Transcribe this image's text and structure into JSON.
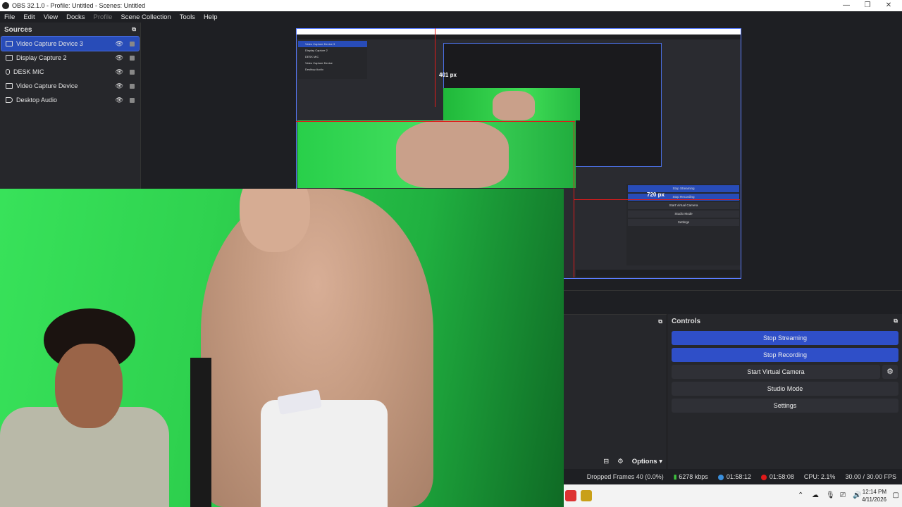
{
  "window": {
    "title": "OBS 32.1.0 - Profile: Untitled - Scenes: Untitled"
  },
  "menu": [
    "File",
    "Edit",
    "View",
    "Docks",
    "Profile",
    "Scene Collection",
    "Tools",
    "Help"
  ],
  "sources": {
    "title": "Sources",
    "items": [
      {
        "label": "Video Capture Device 3",
        "icon": "camera-icon",
        "selected": true
      },
      {
        "label": "Display Capture 2",
        "icon": "monitor-icon",
        "selected": false
      },
      {
        "label": "DESK MIC",
        "icon": "mic-icon",
        "selected": false
      },
      {
        "label": "Video Capture Device",
        "icon": "camera-icon",
        "selected": false
      },
      {
        "label": "Desktop Audio",
        "icon": "speaker-icon",
        "selected": false
      }
    ]
  },
  "preview": {
    "width_label": "401 px",
    "height_label": "720 px",
    "inner_controls": [
      "Stop Streaming",
      "Stop Recording",
      "Start Virtual Camera",
      "Studio Mode",
      "Settings"
    ]
  },
  "controls": {
    "title": "Controls",
    "buttons": {
      "stop_streaming": "Stop Streaming",
      "stop_recording": "Stop Recording",
      "start_virtual_camera": "Start Virtual Camera",
      "studio_mode": "Studio Mode",
      "settings": "Settings"
    }
  },
  "audio_mixer": {
    "options_label": "Options"
  },
  "status": {
    "dropped_frames": "Dropped Frames 40 (0.0%)",
    "bitrate": "6278 kbps",
    "stream_time": "01:58:12",
    "rec_time": "01:58:08",
    "cpu": "CPU: 2.1%",
    "fps": "30.00 / 30.00 FPS"
  },
  "taskbar": {
    "time": "12:14 PM",
    "date": "4/11/2026"
  },
  "colors": {
    "accent": "#2f4fc8",
    "selection": "#284cb8",
    "rec_red": "#e01a1a",
    "stream_green": "#3ec43e"
  }
}
